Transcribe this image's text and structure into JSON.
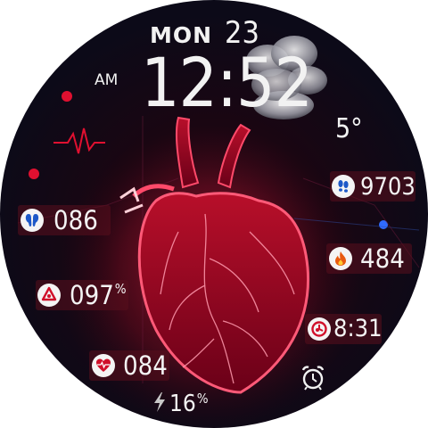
{
  "header": {
    "day": "MON",
    "date": "23"
  },
  "clock": {
    "ampm": "AM",
    "time": "12:52"
  },
  "weather": {
    "temperature": "5°",
    "icon": "cloud-icon"
  },
  "stats": {
    "kidney": {
      "value": "086",
      "icon": "kidney-icon"
    },
    "oxygen": {
      "value": "097",
      "unit": "%",
      "icon": "blood-drop-icon"
    },
    "heart_rate": {
      "value": "084",
      "icon": "heart-pulse-icon"
    },
    "battery": {
      "value": "16",
      "unit": "%",
      "icon": "lightning-icon"
    },
    "steps": {
      "value": "9703",
      "icon": "footsteps-icon"
    },
    "calories": {
      "value": "484",
      "icon": "flame-icon"
    },
    "sleep": {
      "value": "8:31",
      "icon": "sleep-icon"
    },
    "alarm": {
      "icon": "alarm-clock-icon"
    }
  },
  "colors": {
    "accent": "#e01030",
    "background": "#0c0a18",
    "text": "#f2f2f2"
  }
}
